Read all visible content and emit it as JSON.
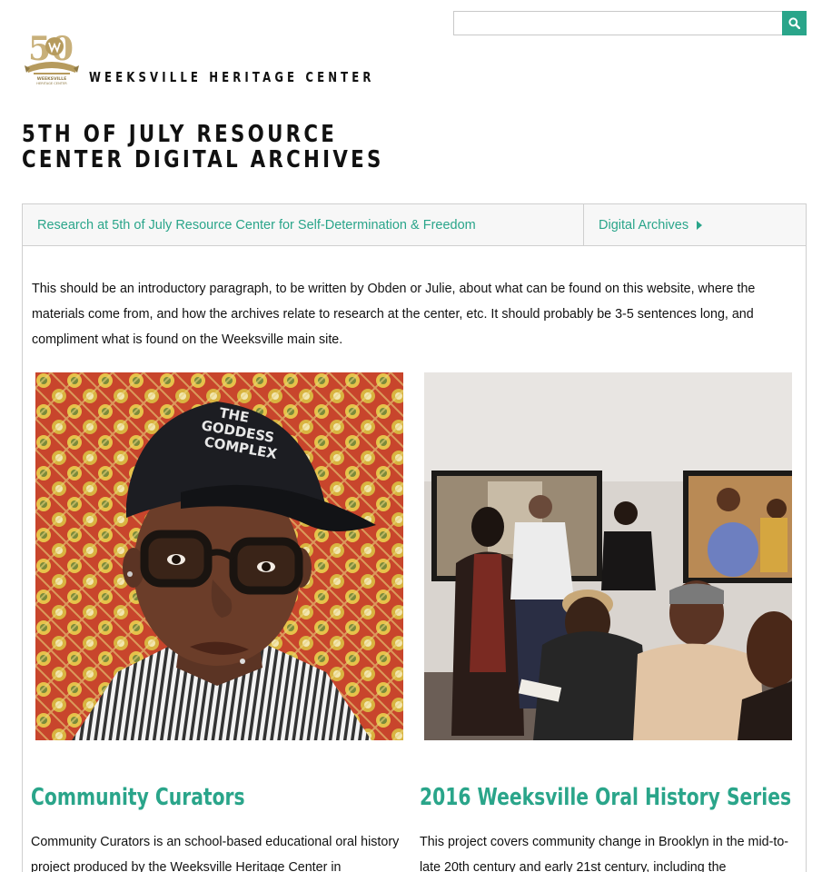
{
  "header": {
    "brand": "WEEKSVILLE HERITAGE CENTER",
    "logo_text": "WEEKSVILLE HERITAGE CENTER",
    "logo_number": "50",
    "search": {
      "placeholder": "",
      "value": ""
    },
    "accent": "#2aa58a",
    "gold": "#b69b5d"
  },
  "page": {
    "title_line1": "5TH OF JULY RESOURCE",
    "title_line2": "CENTER DIGITAL ARCHIVES"
  },
  "tabs": [
    {
      "label": "Research at 5th of July Resource Center for Self-Determination & Freedom"
    },
    {
      "label": "Digital Archives"
    }
  ],
  "intro": "This should be an introductory paragraph, to be written by Obden or Julie, about what can be found on this website, where the materials come from, and how the archives relate to research at the center, etc. It should probably be 3-5 sentences long, and compliment what is found on the Weeksville main site.",
  "cards": [
    {
      "title": "Community Curators",
      "image": "portrait-photo",
      "cap_text": "THE GODDESS COMPLEX",
      "description": "Community Curators is an school-based educational oral history project produced by the Weeksville Heritage Center in"
    },
    {
      "title": "2016 Weeksville Oral History Series",
      "image": "gallery-photo",
      "description": "This project covers community change in Brooklyn in the mid-to-late 20th century and early 21st century, including the"
    }
  ]
}
